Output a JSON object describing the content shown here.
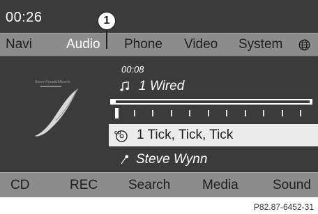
{
  "status": {
    "time": "00:26"
  },
  "top_nav": {
    "items": [
      "Navi",
      "Audio",
      "Phone",
      "Video",
      "System"
    ],
    "selected": "Audio",
    "globe_icon": "globe-icon"
  },
  "callout": {
    "number": "1"
  },
  "player": {
    "elapsed": "00:08",
    "source_line": "1 Wired",
    "progress": 0.02,
    "track_count_marks": 11,
    "current_track_index": 0,
    "track_title": "1 Tick, Tick, Tick",
    "artist": "Steve Wynn",
    "icons": {
      "source": "music-note-icon",
      "track": "cd-icon",
      "artist": "artist-icon"
    },
    "album_art": "album-cover-image"
  },
  "bottom_bar": {
    "items": [
      "CD",
      "REC",
      "Search",
      "Media",
      "Sound"
    ]
  },
  "figure_code": "P82.87-6452-31",
  "colors": {
    "screen_bg": "#3b3b3b",
    "bar_bg": "#8c8c8c",
    "highlight_row": "#ececec",
    "text_light": "#ffffff",
    "text_dark": "#1e1e1e"
  }
}
